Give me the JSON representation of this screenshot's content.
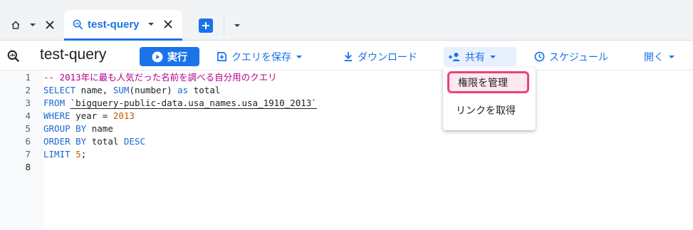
{
  "tabs": {
    "home": {
      "icon": "home-icon"
    },
    "active": {
      "label": "test-query",
      "icon": "query-icon"
    },
    "new_tab_icon": "plus-icon"
  },
  "toolbar": {
    "title": "test-query",
    "run_label": "実行",
    "save_label": "クエリを保存",
    "download_label": "ダウンロード",
    "share_label": "共有",
    "schedule_label": "スケジュール",
    "open_label": "開く"
  },
  "editor": {
    "line_numbers": [
      "1",
      "2",
      "3",
      "4",
      "5",
      "6",
      "7",
      "8"
    ],
    "lines": {
      "l1": {
        "comment": "-- 2013年に最も人気だった名前を調べる自分用のクエリ"
      },
      "l2": {
        "kw1": "SELECT",
        "t1": " name, ",
        "fn": "SUM",
        "t2": "(number) ",
        "kw2": "as",
        "t3": " total"
      },
      "l3": {
        "kw1": "FROM",
        "t1": " ",
        "table": "`bigquery-public-data.usa_names.usa_1910_2013`"
      },
      "l4": {
        "kw1": "WHERE",
        "t1": " year = ",
        "num": "2013"
      },
      "l5": {
        "kw1": "GROUP BY",
        "t1": " name"
      },
      "l6": {
        "kw1": "ORDER BY",
        "t1": " total ",
        "kw2": "DESC"
      },
      "l7": {
        "kw1": "LIMIT",
        "t1": " ",
        "num": "5",
        "t2": ";"
      }
    }
  },
  "share_menu": {
    "items": [
      {
        "label": "権限を管理",
        "highlighted": true
      },
      {
        "label": "リンクを取得",
        "highlighted": false
      }
    ]
  },
  "colors": {
    "accent": "#1a73e8",
    "highlight_border": "#e8437b",
    "comment": "#b5008c",
    "keyword": "#1a67d2",
    "number": "#c45a00"
  }
}
